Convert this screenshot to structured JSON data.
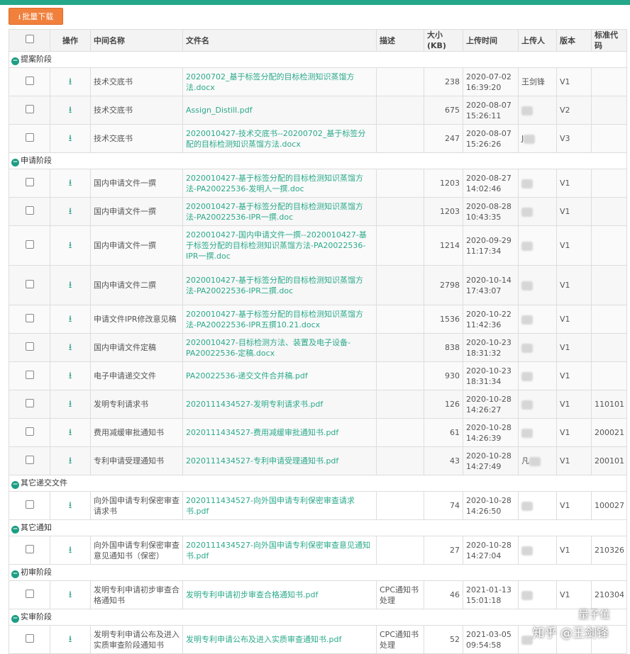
{
  "toolbar": {
    "batch_download_label": "批量下载"
  },
  "columns": [
    "操作",
    "中间名称",
    "文件名",
    "描述",
    "大小(KB)",
    "上传时间",
    "上传人",
    "版本",
    "标准代码"
  ],
  "groups": [
    {
      "title": "提案阶段",
      "rows": [
        {
          "name": "技术交底书",
          "file": "20200702_基于标签分配的目标检测知识蒸馏方法.docx",
          "desc": "",
          "size": "238",
          "time": "2020-07-02 16:39:20",
          "uploader": "王剑锋",
          "version": "V1",
          "code": ""
        },
        {
          "name": "技术交底书",
          "file": "Assign_Distill.pdf",
          "desc": "",
          "size": "675",
          "time": "2020-08-07 15:26:11",
          "uploader": "",
          "version": "V2",
          "code": ""
        },
        {
          "name": "技术交底书",
          "file": "2020010427-技术交底书--20200702_基于标签分配的目标检测知识蒸馏方法.docx",
          "desc": "",
          "size": "247",
          "time": "2020-08-07 15:26:26",
          "uploader": "J",
          "version": "V3",
          "code": ""
        }
      ]
    },
    {
      "title": "申请阶段",
      "rows": [
        {
          "name": "国内申请文件一撰",
          "file": "2020010427-基于标签分配的目标检测知识蒸馏方法-PA20022536-发明人一撰.doc",
          "desc": "",
          "size": "1203",
          "time": "2020-08-27 14:02:46",
          "uploader": "",
          "version": "V1",
          "code": ""
        },
        {
          "name": "国内申请文件一撰",
          "file": "2020010427-基于标签分配的目标检测知识蒸馏方法-PA20022536-IPR一撰.doc",
          "desc": "",
          "size": "1203",
          "time": "2020-08-28 10:43:35",
          "uploader": "",
          "version": "V1",
          "code": ""
        },
        {
          "name": "国内申请文件一撰",
          "file": "2020010427-国内申请文件一撰--2020010427-基于标签分配的目标检测知识蒸馏方法-PA20022536-IPR一撰.doc",
          "desc": "",
          "size": "1214",
          "time": "2020-09-29 11:17:34",
          "uploader": "",
          "version": "V1",
          "code": ""
        },
        {
          "name": "国内申请文件二撰",
          "file": "2020010427-基于标签分配的目标检测知识蒸馏方法-PA20022536-IPR二撰.doc",
          "desc": "",
          "size": "2798",
          "time": "2020-10-14 17:43:07",
          "uploader": "",
          "version": "V1",
          "code": ""
        },
        {
          "name": "申请文件IPR修改意见稿",
          "file": "2020010427-基于标签分配的目标检测知识蒸馏方法-PA20022536-IPR五撰10.21.docx",
          "desc": "",
          "size": "1536",
          "time": "2020-10-22 11:42:36",
          "uploader": "",
          "version": "V1",
          "code": ""
        },
        {
          "name": "国内申请文件定稿",
          "file": "2020010427-目标检测方法、装置及电子设备-PA20022536-定稿.docx",
          "desc": "",
          "size": "838",
          "time": "2020-10-23 18:31:32",
          "uploader": "",
          "version": "V1",
          "code": ""
        },
        {
          "name": "电子申请递交文件",
          "file": "PA20022536-递交文件合并稿.pdf",
          "desc": "",
          "size": "930",
          "time": "2020-10-23 18:31:34",
          "uploader": "",
          "version": "V1",
          "code": ""
        },
        {
          "name": "发明专利请求书",
          "file": "2020111434527-发明专利请求书.pdf",
          "desc": "",
          "size": "126",
          "time": "2020-10-28 14:26:27",
          "uploader": "",
          "version": "V1",
          "code": "110101"
        },
        {
          "name": "费用减缓审批通知书",
          "file": "2020111434527-费用减缓审批通知书.pdf",
          "desc": "",
          "size": "61",
          "time": "2020-10-28 14:26:39",
          "uploader": "",
          "version": "V1",
          "code": "200021"
        },
        {
          "name": "专利申请受理通知书",
          "file": "2020111434527-专利申请受理通知书.pdf",
          "desc": "",
          "size": "43",
          "time": "2020-10-28 14:27:49",
          "uploader": "凡",
          "version": "V1",
          "code": "200101"
        }
      ]
    },
    {
      "title": "其它递交文件",
      "rows": [
        {
          "name": "向外国申请专利保密审查请求书",
          "file": "2020111434527-向外国申请专利保密审查请求书.pdf",
          "desc": "",
          "size": "74",
          "time": "2020-10-28 14:26:50",
          "uploader": "",
          "version": "V1",
          "code": "100027"
        }
      ]
    },
    {
      "title": "其它通知",
      "rows": [
        {
          "name": "向外国申请专利保密审查意见通知书（保密）",
          "file": "2020111434527-向外国申请专利保密审查意见通知书.pdf",
          "desc": "",
          "size": "27",
          "time": "2020-10-28 14:27:04",
          "uploader": "",
          "version": "V1",
          "code": "210326"
        }
      ]
    },
    {
      "title": "初审阶段",
      "rows": [
        {
          "name": "发明专利申请初步审查合格通知书",
          "file": "发明专利申请初步审查合格通知书.pdf",
          "desc": "CPC通知书处理",
          "size": "46",
          "time": "2021-01-13 15:01:18",
          "uploader": "",
          "version": "V1",
          "code": "210304"
        }
      ]
    },
    {
      "title": "实审阶段",
      "rows": [
        {
          "name": "发明专利申请公布及进入实质审查阶段通知书",
          "file": "发明专利申请公布及进入实质审查通知书.pdf",
          "desc": "CPC通知书处理",
          "size": "52",
          "time": "2021-03-05 09:54:58",
          "uploader": "",
          "version": "",
          "code": ""
        }
      ]
    }
  ],
  "watermark": {
    "brand": "量子位",
    "author": "知乎 @王剑锋"
  },
  "colors": {
    "accent": "#25a88a",
    "button": "#f0803c",
    "link": "#2ba98a"
  }
}
